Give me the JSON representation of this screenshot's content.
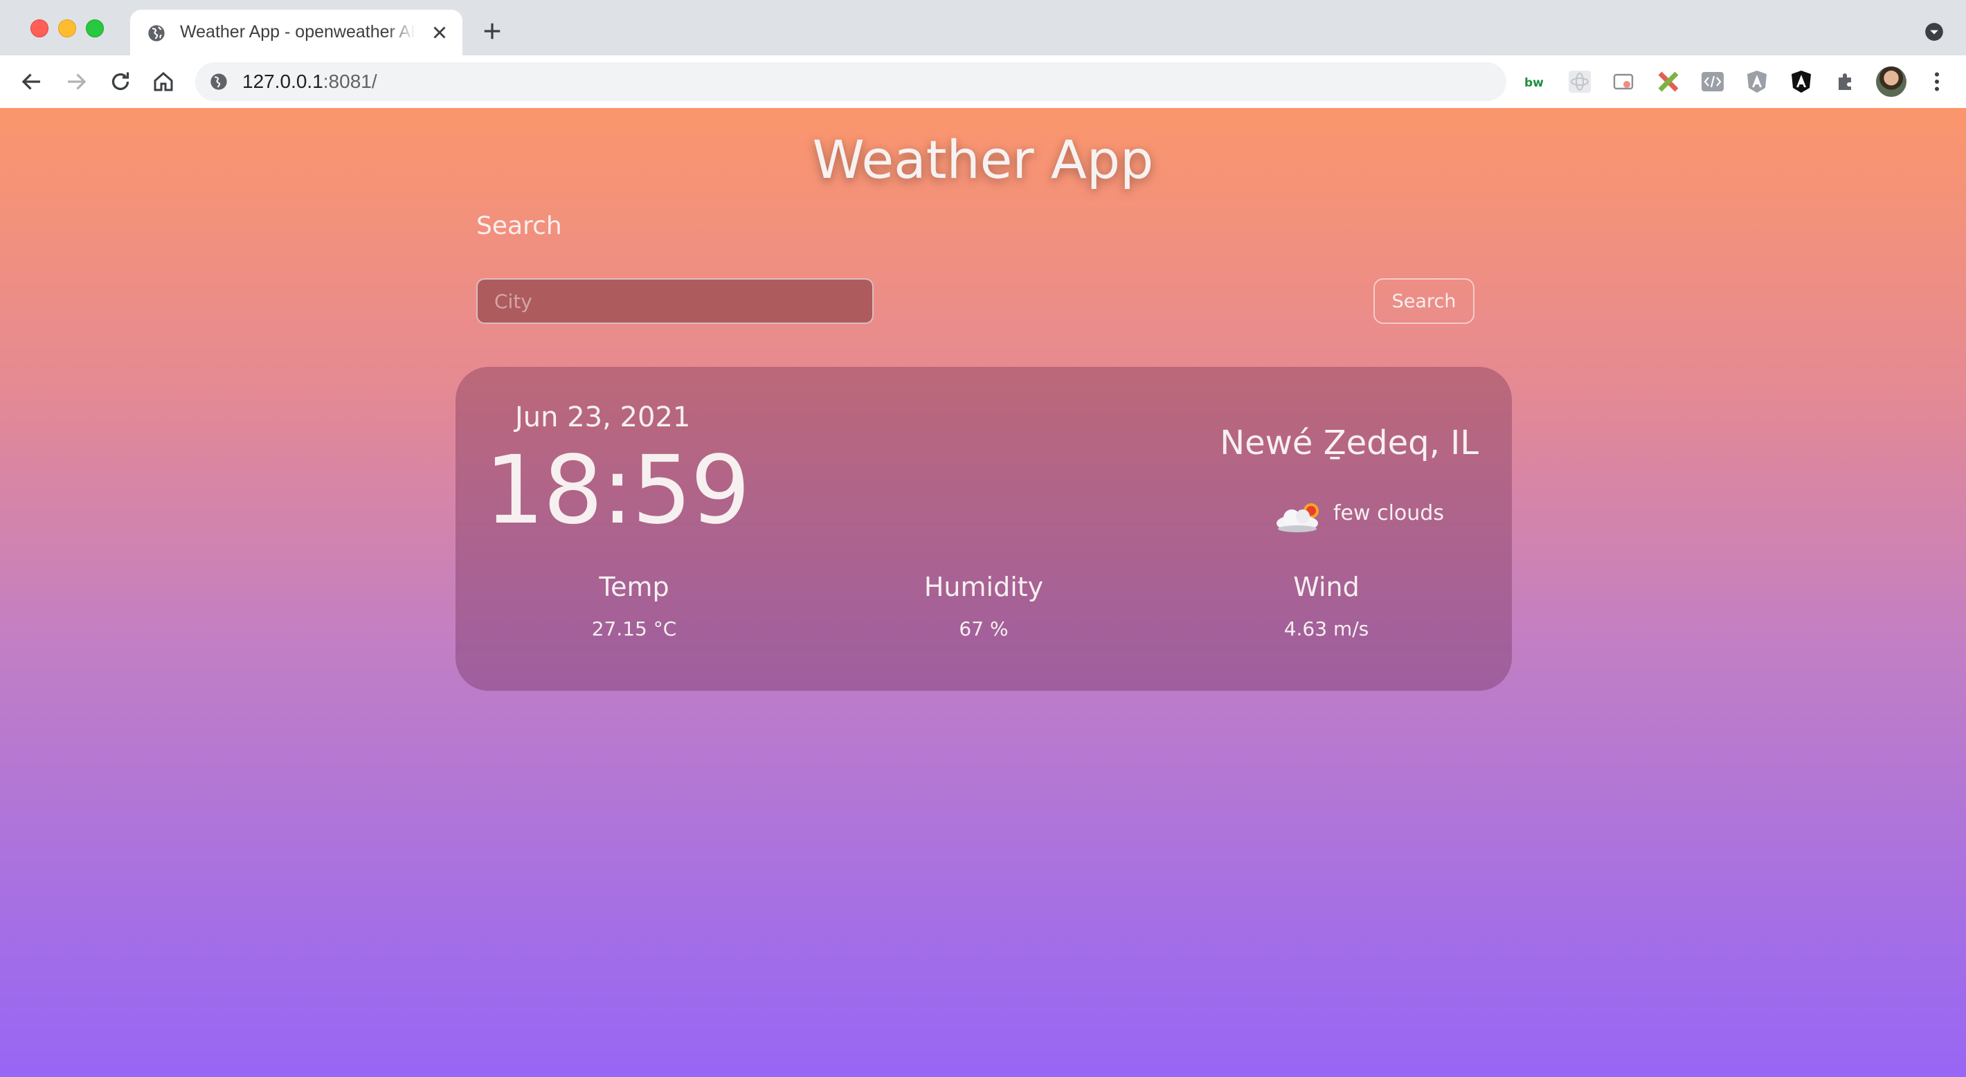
{
  "browser": {
    "tab_title": "Weather App - openweather API",
    "url_host": "127.0.0.1",
    "url_rest": ":8081/",
    "icons": [
      "globe-icon",
      "close-icon",
      "plus-icon",
      "back-icon",
      "forward-icon",
      "reload-icon",
      "home-icon",
      "extensions-icon",
      "menu-icon"
    ]
  },
  "app": {
    "title": "Weather App",
    "search_label": "Search",
    "city_placeholder": "City",
    "search_button": "Search"
  },
  "weather": {
    "date": "Jun 23, 2021",
    "time": "18:59",
    "city": "Newé Ẕedeq, IL",
    "description": "few clouds",
    "icon": "few-clouds-icon",
    "stats": [
      {
        "label": "Temp",
        "value": "27.15 °C"
      },
      {
        "label": "Humidity",
        "value": "67 %"
      },
      {
        "label": "Wind",
        "value": "4.63 m/s"
      }
    ]
  },
  "colors": {
    "gradient_top": "#fb966c",
    "gradient_bottom": "#9866f4"
  }
}
